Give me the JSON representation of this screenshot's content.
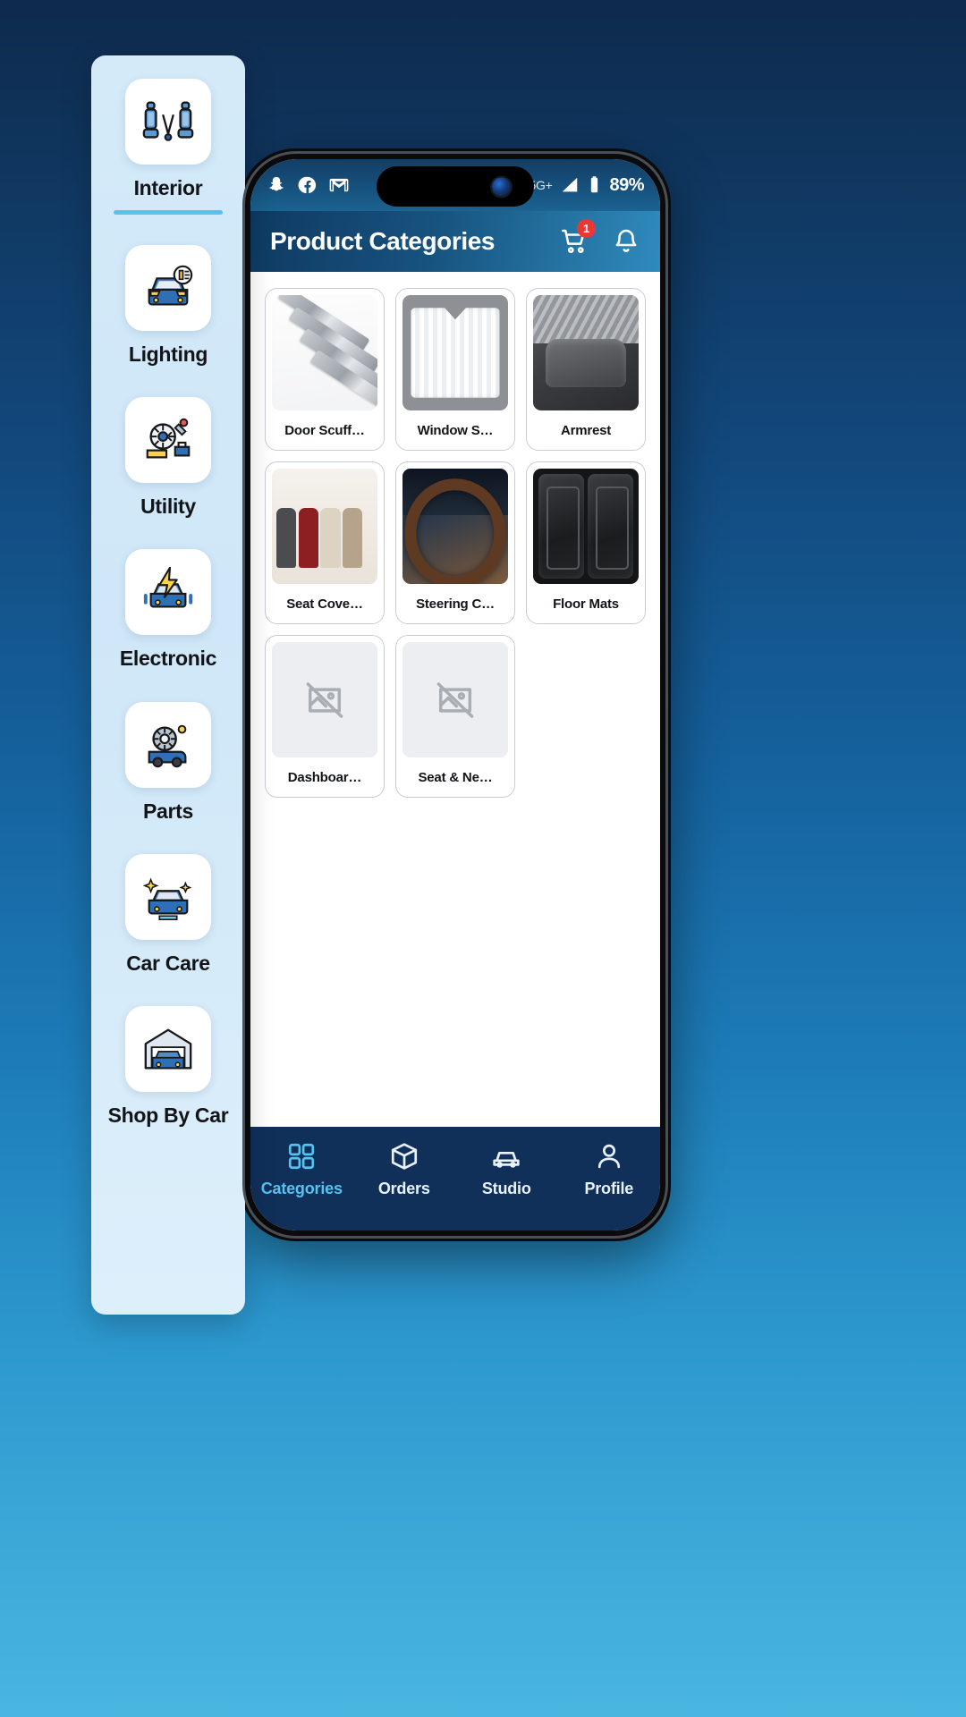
{
  "statusbar": {
    "left_icons": [
      "snapchat-icon",
      "facebook-icon",
      "gmail-icon"
    ],
    "alarm_icon": "alarm-icon",
    "call_wifi_icon": "wifi-calling-icon",
    "data_transfer_icon": "data-transfer-icon",
    "network": "5G+",
    "signal_icon": "signal-bars-icon",
    "battery_icon": "battery-icon",
    "battery_text": "89%"
  },
  "header": {
    "title": "Product Categories",
    "cart_icon": "shopping-cart-icon",
    "cart_badge": "1",
    "bell_icon": "notification-bell-icon"
  },
  "products": [
    {
      "label": "Door Scuff…",
      "art": "art-scuff",
      "placeholder": false
    },
    {
      "label": "Window S…",
      "art": "art-shade",
      "placeholder": false
    },
    {
      "label": "Armrest",
      "art": "art-armrest",
      "placeholder": false
    },
    {
      "label": "Seat Cove…",
      "art": "art-seatcover",
      "placeholder": false
    },
    {
      "label": "Steering C…",
      "art": "art-steer",
      "placeholder": false
    },
    {
      "label": "Floor Mats",
      "art": "art-mats",
      "placeholder": false
    },
    {
      "label": "Dashboar…",
      "art": "",
      "placeholder": true
    },
    {
      "label": "Seat & Ne…",
      "art": "",
      "placeholder": true
    }
  ],
  "bottom_nav": {
    "items": [
      {
        "label": "Categories",
        "icon": "grid-icon",
        "active": true
      },
      {
        "label": "Orders",
        "icon": "box-icon",
        "active": false
      },
      {
        "label": "Studio",
        "icon": "car-icon",
        "active": false
      },
      {
        "label": "Profile",
        "icon": "person-icon",
        "active": false
      }
    ]
  },
  "sidebar": {
    "items": [
      {
        "label": "Interior",
        "icon": "car-seats-icon",
        "selected": true
      },
      {
        "label": "Lighting",
        "icon": "car-headlight-icon",
        "selected": false
      },
      {
        "label": "Utility",
        "icon": "car-tools-icon",
        "selected": false
      },
      {
        "label": "Electronic",
        "icon": "car-electric-icon",
        "selected": false
      },
      {
        "label": "Parts",
        "icon": "car-engine-icon",
        "selected": false
      },
      {
        "label": "Car Care",
        "icon": "car-wash-icon",
        "selected": false
      },
      {
        "label": "Shop By Car",
        "icon": "car-garage-icon",
        "selected": false
      }
    ]
  },
  "colors": {
    "accent": "#56c2f0",
    "header_dark": "#0f3a62",
    "nav_bg": "#10305a",
    "badge_red": "#e53935",
    "sidebar_bg": "#d4eaf9"
  }
}
